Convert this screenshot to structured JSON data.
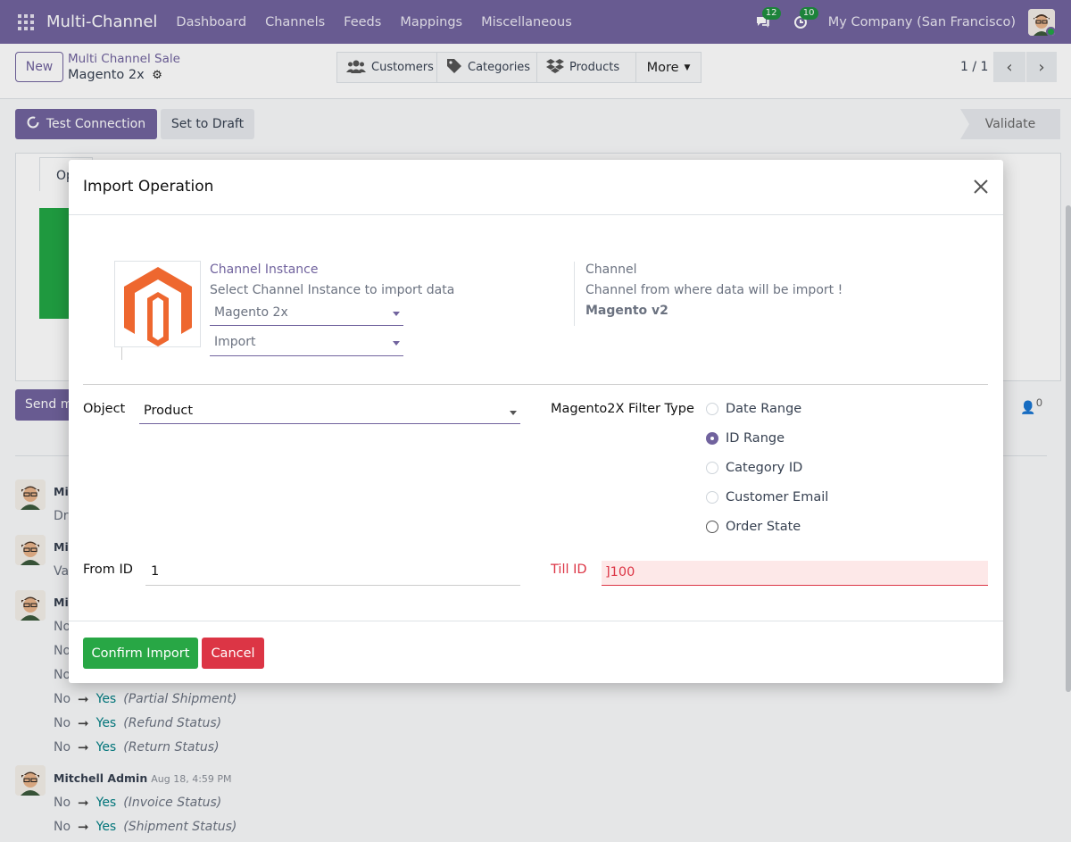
{
  "nav": {
    "app_name": "Multi-Channel",
    "menu": [
      "Dashboard",
      "Channels",
      "Feeds",
      "Mappings",
      "Miscellaneous"
    ],
    "messages_count": "12",
    "activities_count": "10",
    "company": "My Company (San Francisco)"
  },
  "control": {
    "new_label": "New",
    "breadcrumb_parent": "Multi Channel Sale",
    "breadcrumb_current": "Magento 2x",
    "smart_buttons": [
      "Customers",
      "Categories",
      "Products",
      "More"
    ],
    "pager": "1 / 1"
  },
  "status": {
    "test_connection": "Test Connection",
    "set_to_draft": "Set to Draft",
    "validate": "Validate"
  },
  "sheet": {
    "tab_stub": "Op"
  },
  "chatter": {
    "send_stub": "Send m",
    "follower_count": "0",
    "author_stubs": [
      "Mi",
      "Mi",
      "Mi"
    ],
    "line_stubs": [
      "Dr",
      "Va",
      "No",
      "No",
      "No"
    ],
    "tracking": [
      {
        "old": "No",
        "new": "Yes",
        "field": "(Partial Shipment)"
      },
      {
        "old": "No",
        "new": "Yes",
        "field": "(Refund Status)"
      },
      {
        "old": "No",
        "new": "Yes",
        "field": "(Return Status)"
      }
    ],
    "last_author": "Mitchell Admin",
    "last_date": "Aug 18, 4:59 PM",
    "last_tracking": [
      {
        "old": "No",
        "new": "Yes",
        "field": "(Invoice Status)"
      },
      {
        "old": "No",
        "new": "Yes",
        "field": "(Shipment Status)"
      }
    ]
  },
  "dialog": {
    "title": "Import Operation",
    "channel_instance_label": "Channel Instance",
    "channel_instance_help": "Select Channel Instance to import data",
    "channel_instance_value": "Magento 2x",
    "operation_value": "Import",
    "channel_label": "Channel",
    "channel_help": "Channel from where data will be import !",
    "channel_value": "Magento v2",
    "object_label": "Object",
    "object_value": "Product",
    "filter_label": "Magento2X Filter Type",
    "filter_options": [
      "Date Range",
      "ID Range",
      "Category ID",
      "Customer Email",
      "Order State"
    ],
    "filter_selected": "ID Range",
    "from_id_label": "From ID",
    "from_id_value": "1",
    "till_id_label": "Till ID",
    "till_id_value": "]100",
    "confirm": "Confirm Import",
    "cancel": "Cancel"
  },
  "colors": {
    "brand": "#71639e",
    "success": "#28a745",
    "danger": "#dc3545",
    "magento_orange": "#ee672f"
  }
}
